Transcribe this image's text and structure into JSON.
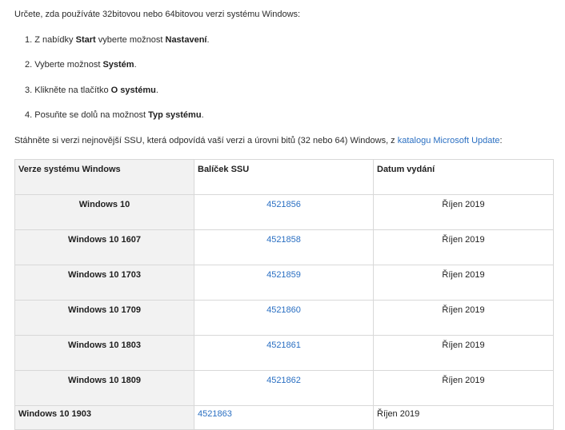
{
  "intro": "Určete, zda používáte 32bitovou nebo 64bitovou verzi systému Windows:",
  "steps": [
    {
      "num": "1.",
      "pre": " Z nabídky ",
      "b1": "Start",
      "mid": " vyberte možnost ",
      "b2": "Nastavení",
      "post": "."
    },
    {
      "num": "2.",
      "pre": " Vyberte možnost ",
      "b1": "Systém",
      "post": "."
    },
    {
      "num": "3.",
      "pre": " Klikněte na tlačítko ",
      "b1": "O systému",
      "post": "."
    },
    {
      "num": "4.",
      "pre": " Posuňte se dolů na možnost ",
      "b1": "Typ systému",
      "post": "."
    }
  ],
  "download_text": "Stáhněte si verzi nejnovější SSU, která odpovídá vaší verzi a úrovni bitů (32 nebo 64) Windows, z ",
  "catalog_link": "katalogu Microsoft Update",
  "download_tail": ":",
  "table": {
    "headers": [
      "Verze systému Windows",
      "Balíček SSU",
      "Datum vydání"
    ],
    "rows": [
      {
        "version": "Windows 10",
        "package": "4521856",
        "date": "Říjen 2019"
      },
      {
        "version": "Windows 10 1607",
        "package": "4521858",
        "date": "Říjen 2019"
      },
      {
        "version": "Windows 10 1703",
        "package": "4521859",
        "date": "Říjen 2019"
      },
      {
        "version": "Windows 10 1709",
        "package": "4521860",
        "date": "Říjen 2019"
      },
      {
        "version": "Windows 10 1803",
        "package": "4521861",
        "date": "Říjen 2019"
      },
      {
        "version": "Windows 10 1809",
        "package": "4521862",
        "date": "Říjen 2019"
      },
      {
        "version": "Windows 10 1903",
        "package": "4521863",
        "date": "Říjen 2019"
      }
    ]
  },
  "colors": {
    "link": "#2a6fc2",
    "row_shade": "#f2f2f2",
    "border": "#d8d8d8"
  }
}
